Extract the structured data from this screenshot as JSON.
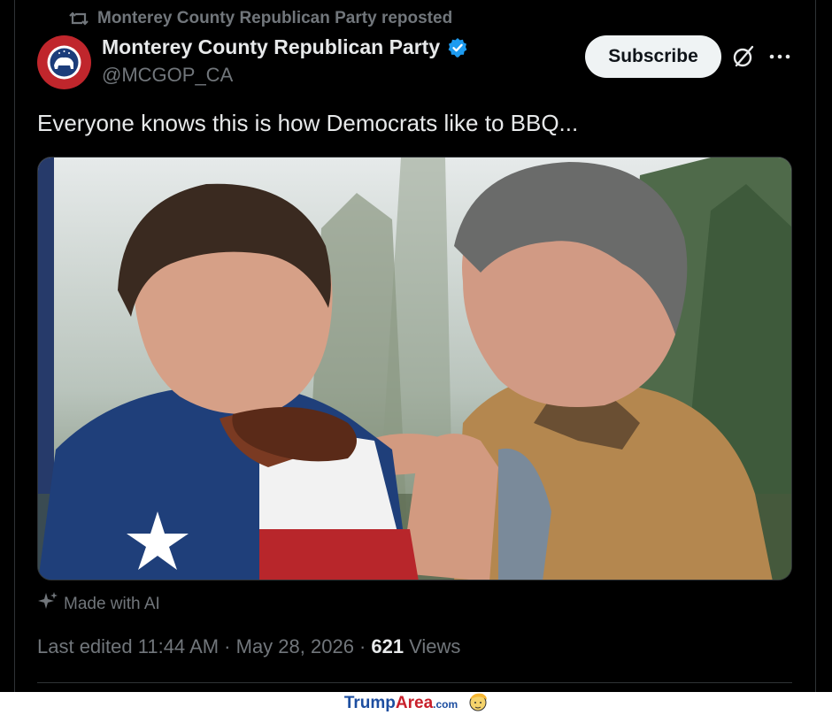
{
  "repost": {
    "label": "Monterey County Republican Party reposted"
  },
  "author": {
    "name": "Monterey County Republican Party",
    "handle": "@MCGOP_CA"
  },
  "actions": {
    "subscribe_label": "Subscribe"
  },
  "post": {
    "text": "Everyone knows this is how Democrats like to BBQ..."
  },
  "media": {
    "ai_label": "Made with AI"
  },
  "meta": {
    "edited": "Last edited 11:44 AM · May 28, 2026 ·",
    "views_count": "621",
    "views_label": "Views"
  },
  "footer": {
    "brand_a": "Trump",
    "brand_b": "Area",
    "brand_c": ".com"
  },
  "icons": [
    "repost-icon",
    "verified-icon",
    "grok-icon",
    "more-icon",
    "sparkle-icon",
    "mascot-icon"
  ],
  "colors": {
    "background": "#000000",
    "text": "#e7e9ea",
    "muted": "#71767b",
    "verified": "#1d9bf0",
    "subscribe_bg": "#eff3f4"
  }
}
